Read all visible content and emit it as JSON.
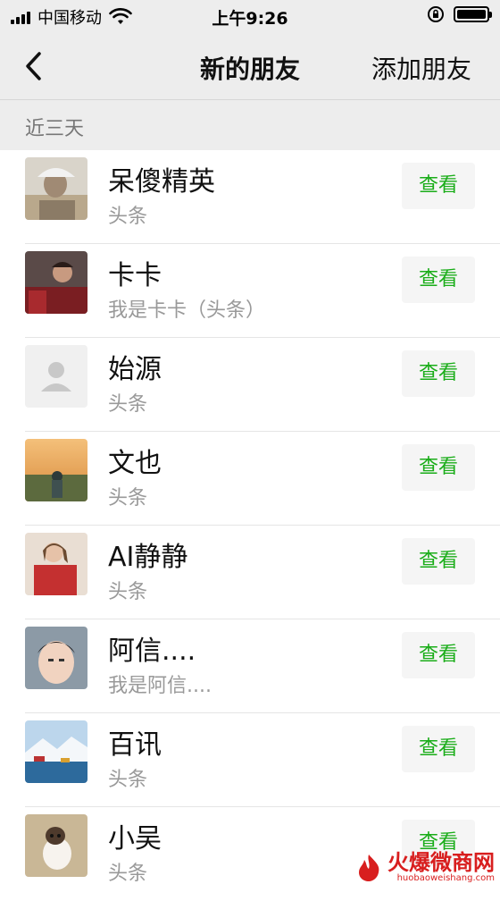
{
  "statusbar": {
    "carrier": "中国移动",
    "time": "上午9:26"
  },
  "navbar": {
    "title": "新的朋友",
    "action": "添加朋友"
  },
  "section": {
    "title": "近三天"
  },
  "friends": [
    {
      "name": "呆傻精英",
      "subtitle": "头条",
      "button": "查看"
    },
    {
      "name": "卡卡",
      "subtitle": "我是卡卡（头条）",
      "button": "查看"
    },
    {
      "name": "始源",
      "subtitle": "头条",
      "button": "查看"
    },
    {
      "name": "文也",
      "subtitle": "头条",
      "button": "查看"
    },
    {
      "name": "AI静静",
      "subtitle": "头条",
      "button": "查看"
    },
    {
      "name": "阿信....",
      "subtitle": "我是阿信....",
      "button": "查看"
    },
    {
      "name": "百讯",
      "subtitle": "头条",
      "button": "查看"
    },
    {
      "name": "小吴",
      "subtitle": "头条",
      "button": "查看"
    }
  ],
  "watermark": {
    "text": "火爆微商网",
    "url": "huobaoweishang.com"
  },
  "colors": {
    "accent": "#1aad19",
    "background": "#ededed"
  }
}
